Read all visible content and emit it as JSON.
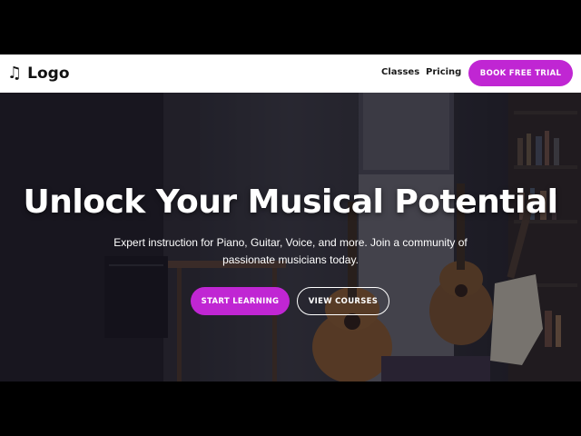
{
  "nav": {
    "logo_icon": "♫",
    "logo_text": "Logo",
    "links": [
      "Classes",
      "Pricing"
    ],
    "cta_label": "BOOK FREE TRIAL"
  },
  "hero": {
    "title": "Unlock Your Musical Potential",
    "subtitle": "Expert instruction for Piano, Guitar, Voice, and more. Join a community of passionate musicians today.",
    "primary_label": "START LEARNING",
    "secondary_label": "VIEW COURSES"
  },
  "colors": {
    "accent": "#c026d3",
    "nav_bg": "#ffffff",
    "text_dark": "#111111"
  }
}
